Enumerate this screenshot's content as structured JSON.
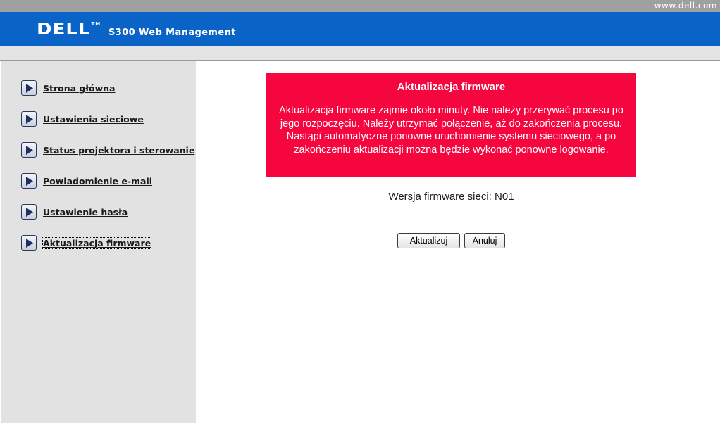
{
  "header": {
    "url": "www.dell.com",
    "logo": "DELL",
    "logo_tm": "TM",
    "product_title": "S300 Web Management"
  },
  "sidebar": {
    "items": [
      {
        "label": "Strona główna"
      },
      {
        "label": "Ustawienia sieciowe"
      },
      {
        "label": "Status projektora i sterowanie"
      },
      {
        "label": "Powiadomienie e-mail"
      },
      {
        "label": "Ustawienie hasła"
      },
      {
        "label": "Aktualizacja firmware",
        "active": true
      }
    ]
  },
  "main": {
    "alert": {
      "title": "Aktualizacja firmware",
      "body": "Aktualizacja firmware zajmie około minuty. Nie należy przerywać procesu po jego rozpoczęciu. Należy utrzymać połączenie, aż do zakończenia procesu. Nastąpi automatyczne ponowne uruchomienie systemu sieciowego, a po zakończeniu aktualizacji można będzie wykonać ponowne logowanie.",
      "color": "#f5063f"
    },
    "version_text": "Wersja firmware sieci: N01",
    "update_button": "Aktualizuj",
    "cancel_button": "Anuluj"
  },
  "colors": {
    "banner": "#0a64c8",
    "sidebar": "#e2e2e2"
  },
  "icons": {
    "nav": "play-arrow-icon"
  }
}
